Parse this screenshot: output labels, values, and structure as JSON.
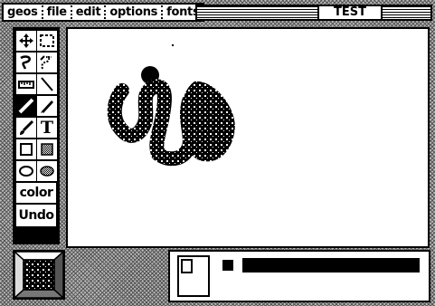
{
  "menu": {
    "items": [
      "geos",
      "file",
      "edit",
      "options",
      "fonts"
    ]
  },
  "window": {
    "title": "TEST"
  },
  "tools": {
    "text_tool_glyph": "T",
    "color_label": "color",
    "undo_label": "Undo",
    "icons": [
      "hand-move-icon",
      "selection-rect-icon",
      "lasso-icon",
      "lasso-select-icon",
      "ruler-icon",
      "line-icon",
      "draw-pencil-icon",
      "pencil-icon",
      "brush-icon",
      "text-icon",
      "hollow-rect-icon",
      "filled-rect-icon",
      "hollow-ellipse-icon",
      "filled-ellipse-icon"
    ],
    "selected": "draw-pencil-icon"
  },
  "colors": {
    "background": "#ffffff",
    "ink": "#000000",
    "desktop_pattern": "#555555"
  }
}
